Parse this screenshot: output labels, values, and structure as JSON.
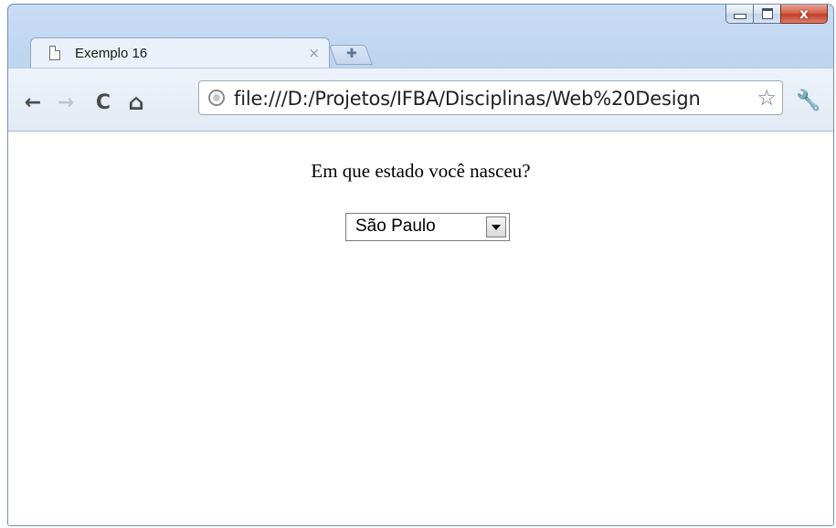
{
  "tab": {
    "title": "Exemplo 16",
    "close_glyph": "×"
  },
  "newtab": {
    "glyph": "✚"
  },
  "window": {
    "close_glyph": "x"
  },
  "toolbar": {
    "back_glyph": "←",
    "forward_glyph": "→",
    "reload_glyph": "C",
    "home_glyph": "⌂",
    "star_glyph": "☆",
    "wrench_glyph": "🔧"
  },
  "address_bar": {
    "url": "file:///D:/Projetos/IFBA/Disciplinas/Web%20Design"
  },
  "page": {
    "question": "Em que estado você nasceu?",
    "select": {
      "selected": "São Paulo"
    }
  },
  "icons": [
    "page-icon",
    "new-tab-icon",
    "back-arrow-icon",
    "forward-arrow-icon",
    "reload-icon",
    "home-icon",
    "globe-icon",
    "star-icon",
    "wrench-icon",
    "dropdown-arrow-icon"
  ]
}
